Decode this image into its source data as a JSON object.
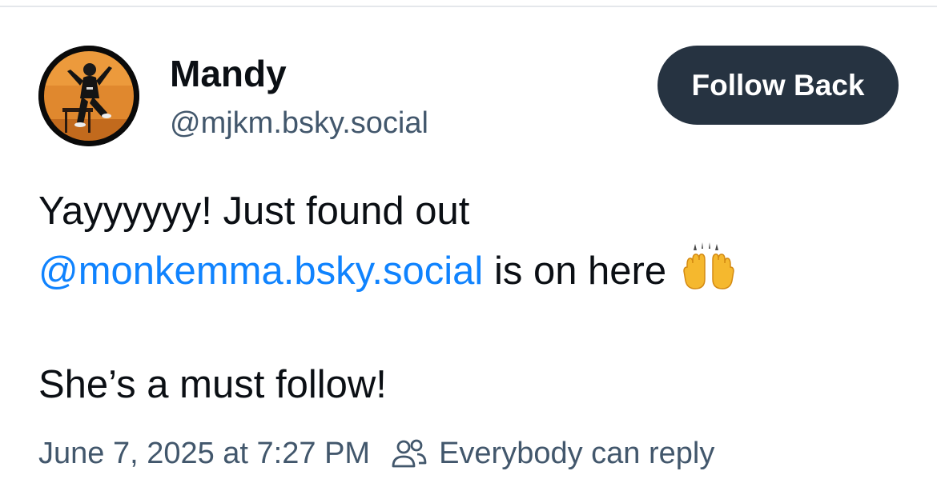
{
  "post": {
    "author": {
      "display_name": "Mandy",
      "handle": "@mjkm.bsky.social",
      "avatar_icon": "user-avatar-photo"
    },
    "follow_button_label": "Follow Back",
    "text": {
      "line1": "Yayyyyyy! Just found out",
      "mention": "@monkemma.bsky.social",
      "line2_rest": " is on here",
      "emoji_icon": "raising-hands-emoji",
      "line3": "She’s a must follow!"
    },
    "timestamp": "June 7, 2025 at 7:27 PM",
    "reply_setting": {
      "icon": "people-icon",
      "label": "Everybody can reply"
    }
  },
  "colors": {
    "text_primary": "#0b0f14",
    "text_secondary": "#42576c",
    "link": "#1083fe",
    "button_bg": "#263341",
    "button_text": "#ffffff",
    "divider": "#e4e7eb"
  }
}
